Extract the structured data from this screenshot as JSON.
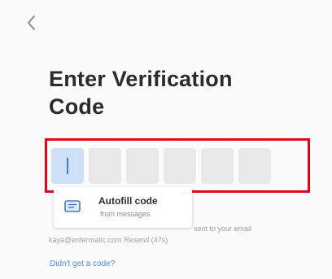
{
  "header": {
    "back_icon": "chevron-left-icon"
  },
  "main": {
    "title": "Enter Verification Code",
    "code_boxes": [
      "",
      "",
      "",
      "",
      "",
      ""
    ],
    "active_index": 0,
    "sent_text": "sent to your email",
    "email_line": "kaya@entermatic.com",
    "resend_label": "Resend (47s)",
    "didnt_get_link": "Didn't get a code?"
  },
  "autofill": {
    "title": "Autofill code",
    "subtitle": "from messages",
    "icon": "message-icon"
  },
  "colors": {
    "accent": "#3d7bd8",
    "active_box": "#cfe0f6",
    "box": "#e9e9e9",
    "highlight": "#e4001b",
    "link": "#4b8ad8"
  }
}
